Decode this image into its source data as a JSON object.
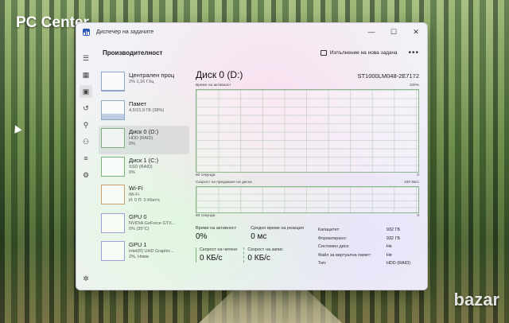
{
  "watermark": "PC Center",
  "bazar_mark": "bazar",
  "window": {
    "title": "Диспечер на задачите",
    "minimize": "—",
    "maximize": "☐",
    "close": "✕"
  },
  "nav": {
    "items": [
      "menu-icon",
      "processes-icon",
      "performance-icon",
      "history-icon",
      "startup-icon",
      "users-icon",
      "details-icon",
      "services-icon"
    ],
    "settings": "settings-icon"
  },
  "header": {
    "title": "Производителност",
    "run_task": "Изпълнение на нова задача",
    "more": "•••"
  },
  "sidebar": {
    "items": [
      {
        "name": "Централен проц",
        "sub": "2% 1,16 ГХц"
      },
      {
        "name": "Памет",
        "sub": "4,5/15,9 ГБ (28%)"
      },
      {
        "name": "Диск 0 (D:)",
        "sub": "HDD (RAID)",
        "sub2": "0%"
      },
      {
        "name": "Диск 1 (C:)",
        "sub": "SSD (RAID)",
        "sub2": "0%"
      },
      {
        "name": "Wi-Fi",
        "sub": "Wi-Fi",
        "sub2": "И: 0 П: 0 Кбит/с"
      },
      {
        "name": "GPU 0",
        "sub": "NVIDIA GeForce GTX...",
        "sub2": "0% (35°C)"
      },
      {
        "name": "GPU 1",
        "sub": "Intel(R) UHD Graphic...",
        "sub2": "2%, Няма"
      }
    ]
  },
  "main": {
    "title": "Диск 0 (D:)",
    "model": "ST1000LM048-2E7172",
    "active_label": "Време на активност",
    "active_max": "100%",
    "seconds_label": "60 секунди",
    "zero": "0",
    "transfer_label": "Скорост на предаване на диска",
    "transfer_max": "100 КБ/с",
    "stats": {
      "active_time_label": "Време на активност",
      "active_time_value": "0%",
      "avg_response_label": "Средно време на реакция",
      "avg_response_value": "0 мс",
      "read_label": "Скорост на четене",
      "read_value": "0 КБ/с",
      "write_label": "Скорост на запис",
      "write_value": "0 КБ/с"
    },
    "info": [
      {
        "key": "Капацитет:",
        "value": "932 ГБ"
      },
      {
        "key": "Форматирано:",
        "value": "932 ГБ"
      },
      {
        "key": "Системен диск:",
        "value": "Не"
      },
      {
        "key": "Файл за виртуална памет:",
        "value": "Не"
      },
      {
        "key": "Тип:",
        "value": "HDD (RAID)"
      }
    ]
  }
}
